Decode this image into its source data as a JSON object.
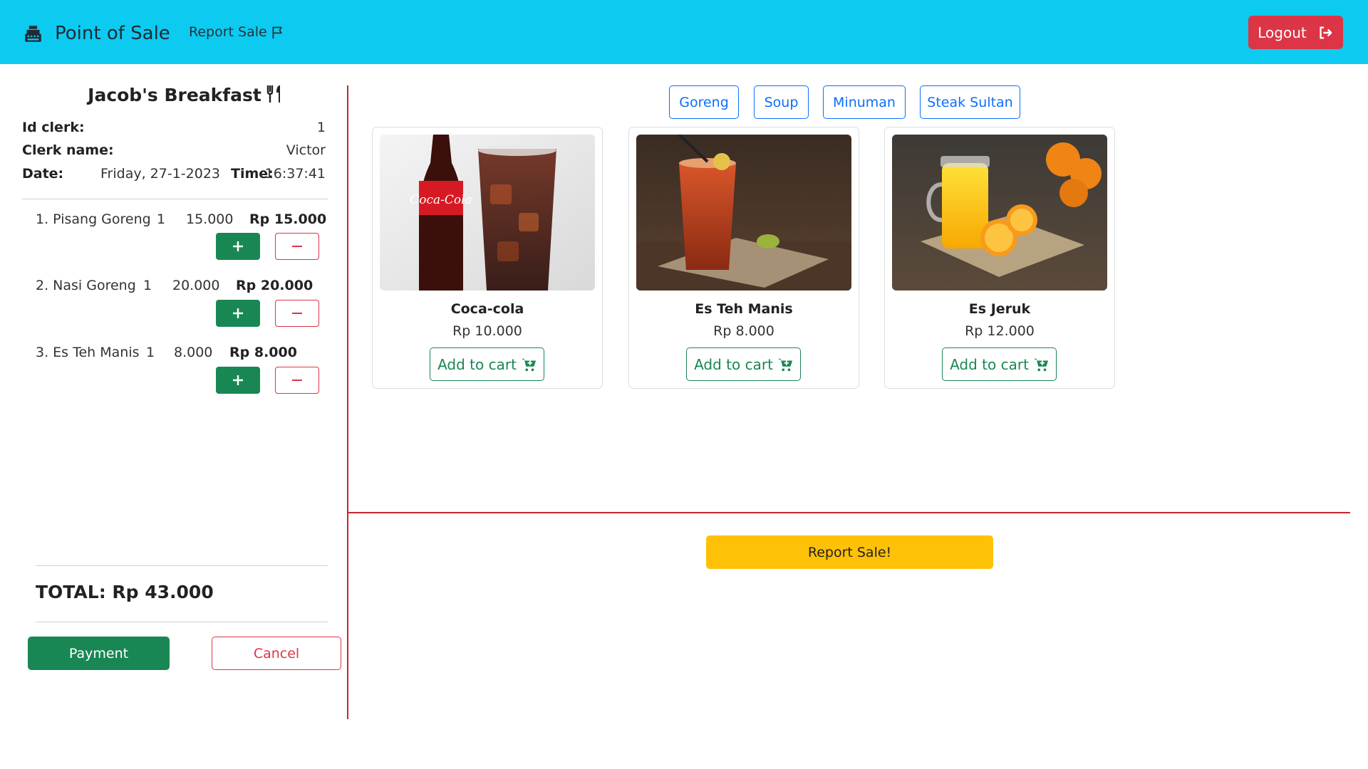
{
  "nav": {
    "brand": "Point of Sale",
    "brand_icon": "cash-register-icon",
    "report_link": "Report Sale",
    "report_icon": "flag-icon",
    "logout": "Logout",
    "logout_icon": "logout-icon"
  },
  "receipt": {
    "shop_name": "Jacob's Breakfast",
    "shop_icon": "utensils-icon",
    "id_label": "Id clerk:",
    "id_value": "1",
    "clerk_label": "Clerk name:",
    "clerk_value": "Victor",
    "date_label": "Date:",
    "date_value": "Friday, 27-1-2023",
    "time_label": "Time:",
    "time_value": "16:37:41",
    "items": [
      {
        "name": "1. Pisang Goreng",
        "qty": "1",
        "price": "15.000",
        "subtotal": "Rp 15.000"
      },
      {
        "name": "2. Nasi Goreng",
        "qty": "1",
        "price": "20.000",
        "subtotal": "Rp 20.000"
      },
      {
        "name": "3. Es Teh Manis",
        "qty": "1",
        "price": "8.000",
        "subtotal": "Rp 8.000"
      }
    ],
    "total": "TOTAL: Rp 43.000",
    "payment": "Payment",
    "cancel": "Cancel"
  },
  "categories": [
    "Goreng",
    "Soup",
    "Minuman",
    "Steak Sultan"
  ],
  "products": [
    {
      "name": "Coca-cola",
      "price": "Rp 10.000",
      "button": "Add to cart",
      "image": "coca-cola-image"
    },
    {
      "name": "Es Teh Manis",
      "price": "Rp 8.000",
      "button": "Add to cart",
      "image": "iced-tea-image"
    },
    {
      "name": "Es Jeruk",
      "price": "Rp 12.000",
      "button": "Add to cart",
      "image": "orange-juice-image"
    }
  ],
  "report_button": "Report Sale!",
  "colors": {
    "navbar": "#0dcaf0",
    "danger": "#dc3545",
    "success": "#198754",
    "primary": "#0d6efd",
    "warning": "#ffc107"
  }
}
